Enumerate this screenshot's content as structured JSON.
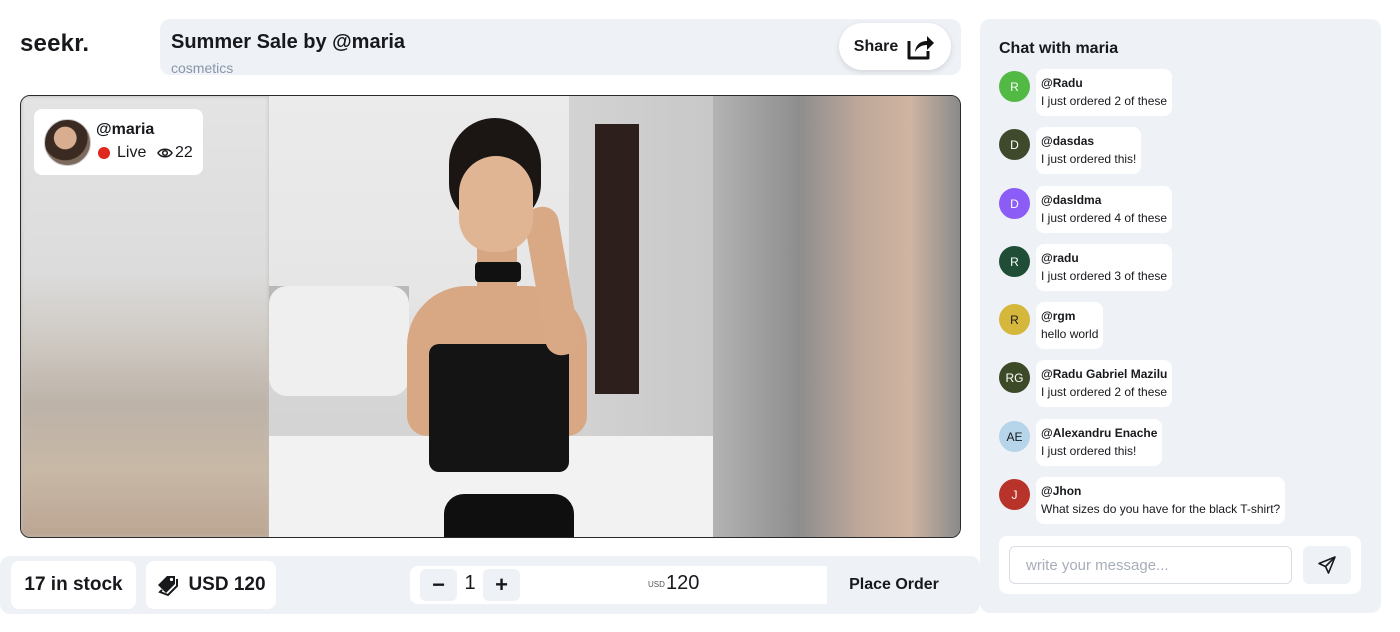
{
  "brand": {
    "logo": "seekr."
  },
  "header": {
    "title": "Summer Sale by @maria",
    "category": "cosmetics",
    "share_label": "Share",
    "share_icon": "share-arrow-icon"
  },
  "stream": {
    "handle": "@maria",
    "status": "Live",
    "status_color": "#e0271d",
    "viewers": "22",
    "viewers_icon": "eye-icon"
  },
  "product": {
    "stock": "17 in stock",
    "price_label": "USD 120",
    "price_icon": "price-tag-icon",
    "quantity": "1",
    "minus_label": "−",
    "plus_label": "+",
    "total_currency": "USD",
    "total_value": "120",
    "order_label": "Place Order"
  },
  "chat": {
    "title": "Chat with maria",
    "messages": [
      {
        "initials": "R",
        "color": "#52b945",
        "user": "@Radu",
        "text": "I just ordered 2 of these"
      },
      {
        "initials": "D",
        "color": "#3f4a2c",
        "user": "@dasdas",
        "text": "I just ordered this!"
      },
      {
        "initials": "D",
        "color": "#8b5cf6",
        "user": "@dasldma",
        "text": "I just ordered 4 of these"
      },
      {
        "initials": "R",
        "color": "#1f4d36",
        "user": "@radu",
        "text": "I just ordered 3 of these"
      },
      {
        "initials": "R",
        "color": "#d4b73b",
        "text_color": "#17191d",
        "user": "@rgm",
        "text": "hello world"
      },
      {
        "initials": "RG",
        "color": "#3d4a27",
        "user": "@Radu Gabriel Mazilu",
        "text": "I just ordered 2 of these"
      },
      {
        "initials": "AE",
        "color": "#b6d4ea",
        "text_color": "#17191d",
        "user": "@Alexandru Enache",
        "text": "I just ordered this!"
      },
      {
        "initials": "J",
        "color": "#b8342a",
        "user": "@Jhon",
        "text": "What sizes do you have for the black T-shirt?"
      }
    ],
    "input_placeholder": "write your message...",
    "send_icon": "send-icon"
  }
}
